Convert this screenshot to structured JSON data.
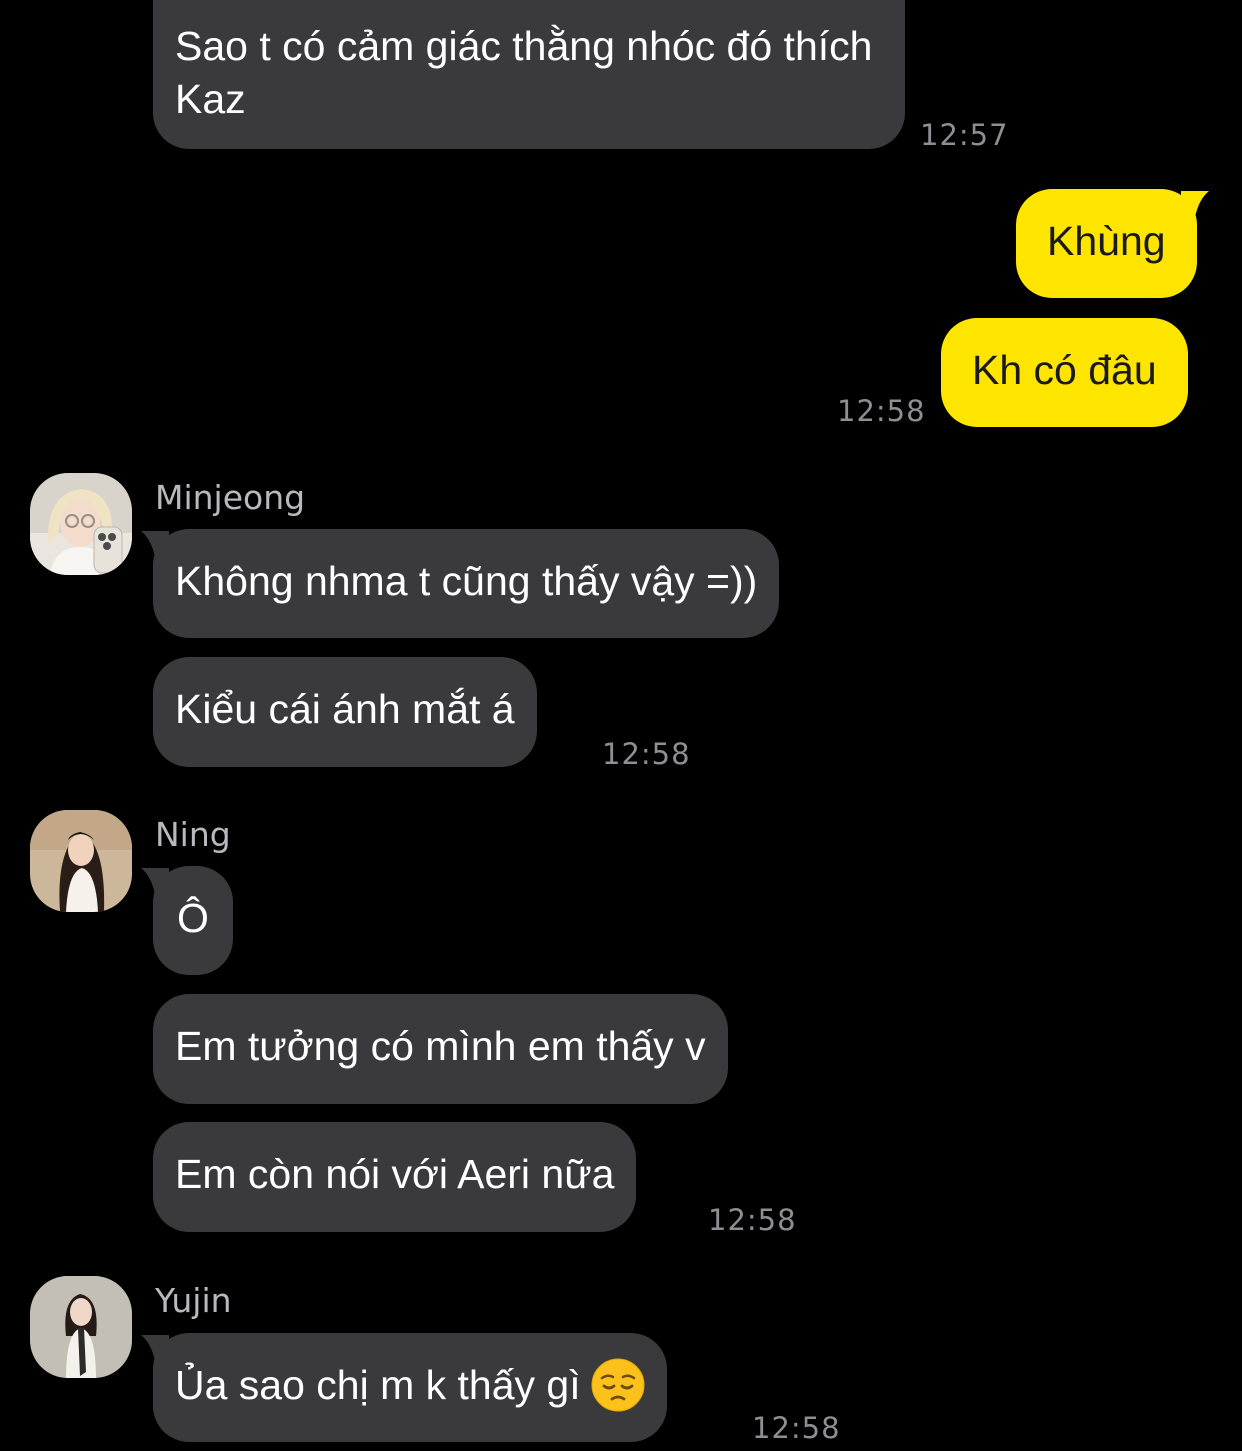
{
  "messages": [
    {
      "id": "m1",
      "sender": "",
      "direction": "incoming",
      "text": "Sao t có cảm giác thằng nhóc đó thích Kaz",
      "time": "12:57"
    },
    {
      "id": "m2",
      "sender": "me",
      "direction": "outgoing",
      "text": "Khùng",
      "time": ""
    },
    {
      "id": "m3",
      "sender": "me",
      "direction": "outgoing",
      "text": "Kh có đâu",
      "time": "12:58"
    },
    {
      "id": "m4",
      "sender": "Minjeong",
      "direction": "incoming",
      "text": "Không nhma t cũng thấy vậy =))",
      "time": ""
    },
    {
      "id": "m5",
      "sender": "Minjeong",
      "direction": "incoming",
      "text": "Kiểu cái ánh mắt á",
      "time": "12:58"
    },
    {
      "id": "m6",
      "sender": "Ning",
      "direction": "incoming",
      "text": "Ô",
      "time": ""
    },
    {
      "id": "m7",
      "sender": "Ning",
      "direction": "incoming",
      "text": "Em tưởng có mình em thấy v",
      "time": ""
    },
    {
      "id": "m8",
      "sender": "Ning",
      "direction": "incoming",
      "text": "Em còn nói với Aeri nữa",
      "time": "12:58"
    },
    {
      "id": "m9",
      "sender": "Yujin",
      "direction": "incoming",
      "text": "Ủa sao chị m k thấy gì",
      "emoji": "pensive-face",
      "time": "12:58"
    }
  ],
  "senders": {
    "minjeong": "Minjeong",
    "ning": "Ning",
    "yujin": "Yujin"
  },
  "colors": {
    "background": "#000000",
    "incoming_bubble": "#3a3a3c",
    "outgoing_bubble": "#fee500",
    "timestamp": "#8e8e93"
  }
}
